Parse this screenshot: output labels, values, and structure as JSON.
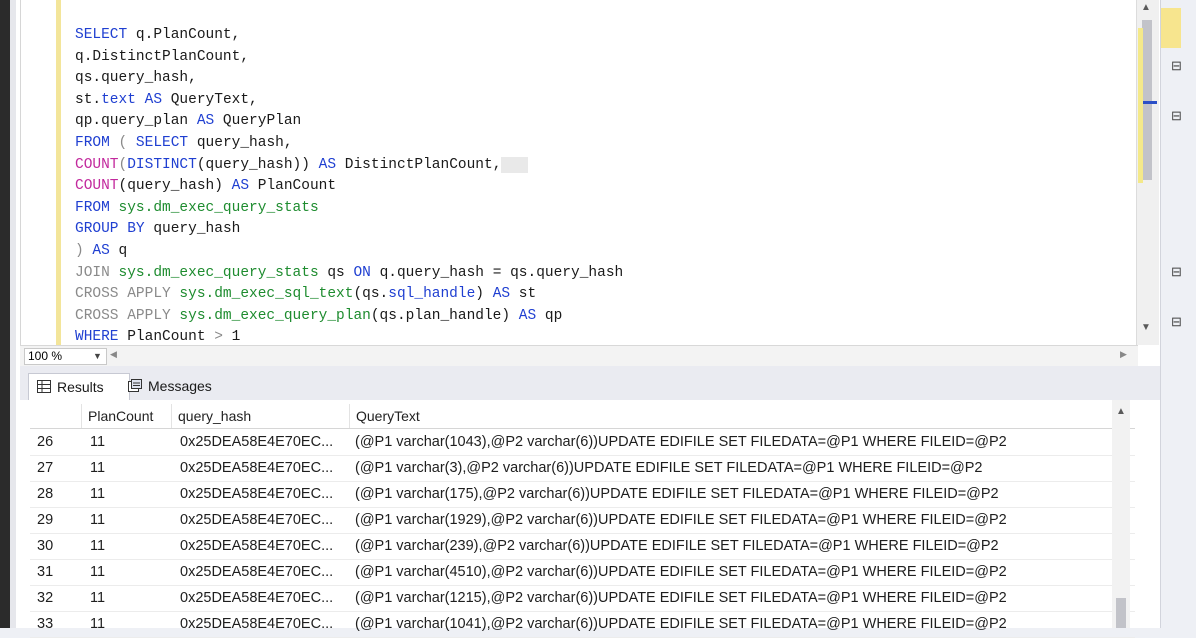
{
  "editor": {
    "lines": [
      [
        {
          "t": "SELECT",
          "c": "kw"
        },
        {
          "t": " q.PlanCount,",
          "c": ""
        }
      ],
      [
        {
          "t": "q.DistinctPlanCount,",
          "c": ""
        }
      ],
      [
        {
          "t": "qs.query_hash,",
          "c": ""
        }
      ],
      [
        {
          "t": "st.",
          "c": ""
        },
        {
          "t": "text",
          "c": "kw"
        },
        {
          "t": " ",
          "c": ""
        },
        {
          "t": "AS",
          "c": "kw"
        },
        {
          "t": " QueryText,",
          "c": ""
        }
      ],
      [
        {
          "t": "qp.query_plan ",
          "c": ""
        },
        {
          "t": "AS",
          "c": "kw"
        },
        {
          "t": " QueryPlan",
          "c": ""
        }
      ],
      [
        {
          "t": "FROM",
          "c": "kw"
        },
        {
          "t": " ( ",
          "c": "gr"
        },
        {
          "t": "SELECT",
          "c": "kw"
        },
        {
          "t": " query_hash,",
          "c": ""
        }
      ],
      [
        {
          "t": "COUNT",
          "c": "fn"
        },
        {
          "t": "(",
          "c": "gr"
        },
        {
          "t": "DISTINCT",
          "c": "kw"
        },
        {
          "t": "(query_hash)) ",
          "c": ""
        },
        {
          "t": "AS",
          "c": "kw"
        },
        {
          "t": " DistinctPlanCount,",
          "c": ""
        },
        {
          "t": "   ",
          "c": "hl"
        }
      ],
      [
        {
          "t": "COUNT",
          "c": "fn"
        },
        {
          "t": "(query_hash) ",
          "c": ""
        },
        {
          "t": "AS",
          "c": "kw"
        },
        {
          "t": " PlanCount",
          "c": ""
        }
      ],
      [
        {
          "t": "FROM",
          "c": "kw"
        },
        {
          "t": " ",
          "c": ""
        },
        {
          "t": "sys.dm_exec_query_stats",
          "c": "sys"
        }
      ],
      [
        {
          "t": "GROUP BY",
          "c": "kw"
        },
        {
          "t": " query_hash",
          "c": ""
        }
      ],
      [
        {
          "t": ") ",
          "c": "gr"
        },
        {
          "t": "AS",
          "c": "kw"
        },
        {
          "t": " q",
          "c": ""
        }
      ],
      [
        {
          "t": "JOIN",
          "c": "gr"
        },
        {
          "t": " ",
          "c": ""
        },
        {
          "t": "sys.dm_exec_query_stats",
          "c": "sys"
        },
        {
          "t": " qs ",
          "c": ""
        },
        {
          "t": "ON",
          "c": "kw"
        },
        {
          "t": " q.query_hash = qs.query_hash",
          "c": ""
        }
      ],
      [
        {
          "t": "CROSS APPLY",
          "c": "gr"
        },
        {
          "t": " ",
          "c": ""
        },
        {
          "t": "sys.dm_exec_sql_text",
          "c": "sys"
        },
        {
          "t": "(qs.",
          "c": ""
        },
        {
          "t": "sql_handle",
          "c": "kw"
        },
        {
          "t": ") ",
          "c": ""
        },
        {
          "t": "AS",
          "c": "kw"
        },
        {
          "t": " st",
          "c": ""
        }
      ],
      [
        {
          "t": "CROSS APPLY",
          "c": "gr"
        },
        {
          "t": " ",
          "c": ""
        },
        {
          "t": "sys.dm_exec_query_plan",
          "c": "sys"
        },
        {
          "t": "(qs.plan_handle) ",
          "c": ""
        },
        {
          "t": "AS",
          "c": "kw"
        },
        {
          "t": " qp",
          "c": ""
        }
      ],
      [
        {
          "t": "WHERE",
          "c": "kw"
        },
        {
          "t": " PlanCount ",
          "c": ""
        },
        {
          "t": ">",
          "c": "gr"
        },
        {
          "t": " 1",
          "c": ""
        }
      ]
    ]
  },
  "zoom": {
    "value": "100 %"
  },
  "tabs": {
    "results": "Results",
    "messages": "Messages"
  },
  "grid": {
    "columns": [
      "PlanCount",
      "query_hash",
      "QueryText"
    ],
    "rows": [
      {
        "n": "26",
        "pc": "11",
        "qh": "0x25DEA58E4E70EC...",
        "qt": "(@P1 varchar(1043),@P2 varchar(6))UPDATE EDIFILE SET FILEDATA=@P1 WHERE FILEID=@P2"
      },
      {
        "n": "27",
        "pc": "11",
        "qh": "0x25DEA58E4E70EC...",
        "qt": "(@P1 varchar(3),@P2 varchar(6))UPDATE EDIFILE SET FILEDATA=@P1 WHERE FILEID=@P2"
      },
      {
        "n": "28",
        "pc": "11",
        "qh": "0x25DEA58E4E70EC...",
        "qt": "(@P1 varchar(175),@P2 varchar(6))UPDATE EDIFILE SET FILEDATA=@P1 WHERE FILEID=@P2"
      },
      {
        "n": "29",
        "pc": "11",
        "qh": "0x25DEA58E4E70EC...",
        "qt": "(@P1 varchar(1929),@P2 varchar(6))UPDATE EDIFILE SET FILEDATA=@P1 WHERE FILEID=@P2"
      },
      {
        "n": "30",
        "pc": "11",
        "qh": "0x25DEA58E4E70EC...",
        "qt": "(@P1 varchar(239),@P2 varchar(6))UPDATE EDIFILE SET FILEDATA=@P1 WHERE FILEID=@P2"
      },
      {
        "n": "31",
        "pc": "11",
        "qh": "0x25DEA58E4E70EC...",
        "qt": "(@P1 varchar(4510),@P2 varchar(6))UPDATE EDIFILE SET FILEDATA=@P1 WHERE FILEID=@P2"
      },
      {
        "n": "32",
        "pc": "11",
        "qh": "0x25DEA58E4E70EC...",
        "qt": "(@P1 varchar(1215),@P2 varchar(6))UPDATE EDIFILE SET FILEDATA=@P1 WHERE FILEID=@P2"
      },
      {
        "n": "33",
        "pc": "11",
        "qh": "0x25DEA58E4E70EC...",
        "qt": "(@P1 varchar(1041),@P2 varchar(6))UPDATE EDIFILE SET FILEDATA=@P1 WHERE FILEID=@P2"
      }
    ]
  },
  "icons": {
    "results_tab": "grid-icon",
    "messages_tab": "messages-icon",
    "right_panel": [
      "collapse-icon",
      "collapse-icon",
      "collapse-icon",
      "collapse-icon"
    ]
  },
  "colors": {
    "keyword": "#1f3fd1",
    "function": "#c2299d",
    "system_object": "#1e8c2f",
    "operator": "#8a8a8a",
    "change_bar": "#f3e59a"
  }
}
